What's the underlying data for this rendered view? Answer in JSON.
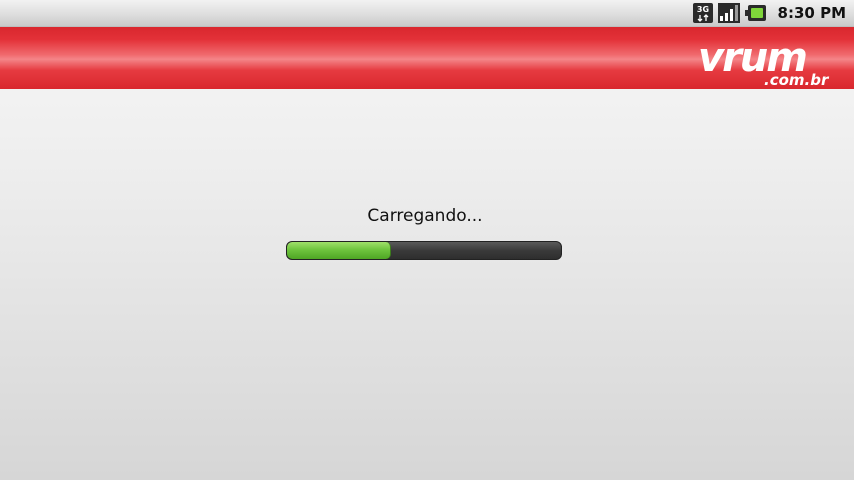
{
  "status_bar": {
    "network_icon": "3g-data-icon",
    "network_label": "3G",
    "signal_icon": "signal-strength-icon",
    "battery_icon": "battery-icon",
    "time": "8:30 PM"
  },
  "header": {
    "logo_text": "vrum",
    "logo_domain": ".com.br",
    "brand_color": "#e0282f"
  },
  "loading": {
    "label": "Carregando...",
    "progress_fraction": 0.38,
    "track_color": "#3a3a3a",
    "fill_color": "#6fc43e"
  }
}
